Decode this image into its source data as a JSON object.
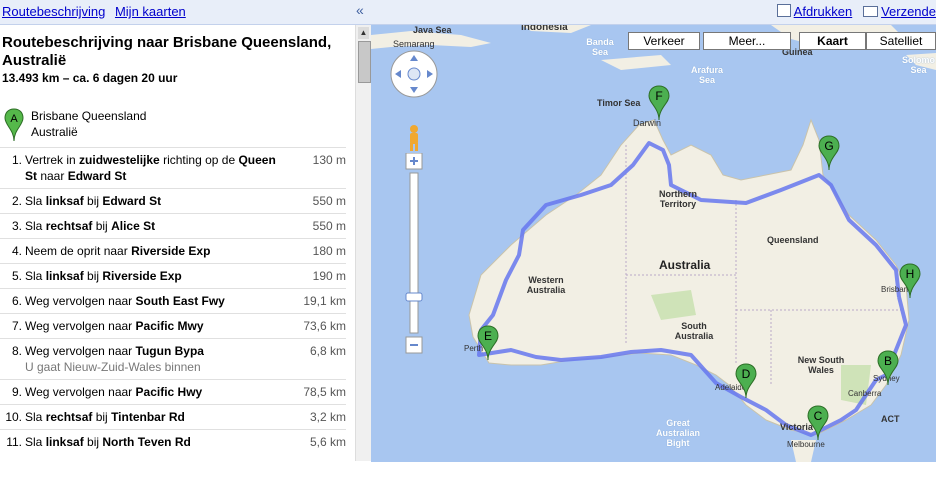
{
  "toplinks": {
    "directions": "Routebeschrijving",
    "mymaps": "Mijn kaarten"
  },
  "collapse_glyph": "«",
  "toolbar": {
    "print": "Afdrukken",
    "send": "Verzende"
  },
  "route": {
    "title": "Routebeschrijving naar Brisbane Queensland, Australië",
    "summary": "13.493 km – ca. 6 dagen 20 uur",
    "start_marker": "A",
    "start_line1": "Brisbane Queensland",
    "start_line2": "Australië",
    "steps": [
      {
        "n": "1.",
        "pre": "Vertrek in ",
        "b1": "zuidwestelijke",
        "mid": " richting op de ",
        "b2": "Queen St",
        "mid2": " naar ",
        "b3": "Edward St",
        "dist": "130 m",
        "note": ""
      },
      {
        "n": "2.",
        "pre": "Sla ",
        "b1": "linksaf",
        "mid": " bij ",
        "b2": "Edward St",
        "mid2": "",
        "b3": "",
        "dist": "550 m",
        "note": ""
      },
      {
        "n": "3.",
        "pre": "Sla ",
        "b1": "rechtsaf",
        "mid": " bij ",
        "b2": "Alice St",
        "mid2": "",
        "b3": "",
        "dist": "550 m",
        "note": ""
      },
      {
        "n": "4.",
        "pre": "Neem de oprit naar ",
        "b1": "Riverside Exp",
        "mid": "",
        "b2": "",
        "mid2": "",
        "b3": "",
        "dist": "180 m",
        "note": ""
      },
      {
        "n": "5.",
        "pre": "Sla ",
        "b1": "linksaf",
        "mid": " bij ",
        "b2": "Riverside Exp",
        "mid2": "",
        "b3": "",
        "dist": "190 m",
        "note": ""
      },
      {
        "n": "6.",
        "pre": "Weg vervolgen naar ",
        "b1": "South East Fwy",
        "mid": "",
        "b2": "",
        "mid2": "",
        "b3": "",
        "dist": "19,1 km",
        "note": ""
      },
      {
        "n": "7.",
        "pre": "Weg vervolgen naar ",
        "b1": "Pacific Mwy",
        "mid": "",
        "b2": "",
        "mid2": "",
        "b3": "",
        "dist": "73,6 km",
        "note": ""
      },
      {
        "n": "8.",
        "pre": "Weg vervolgen naar ",
        "b1": "Tugun Bypa",
        "mid": "",
        "b2": "",
        "mid2": "",
        "b3": "",
        "dist": "6,8 km",
        "note": "U gaat Nieuw-Zuid-Wales binnen"
      },
      {
        "n": "9.",
        "pre": "Weg vervolgen naar ",
        "b1": "Pacific Hwy",
        "mid": "",
        "b2": "",
        "mid2": "",
        "b3": "",
        "dist": "78,5 km",
        "note": ""
      },
      {
        "n": "10.",
        "pre": "Sla ",
        "b1": "rechtsaf",
        "mid": " bij ",
        "b2": "Tintenbar Rd",
        "mid2": "",
        "b3": "",
        "dist": "3,2 km",
        "note": ""
      },
      {
        "n": "11.",
        "pre": "Sla ",
        "b1": "linksaf",
        "mid": " bij ",
        "b2": "North Teven Rd",
        "mid2": "",
        "b3": "",
        "dist": "5,6 km",
        "note": ""
      }
    ]
  },
  "map": {
    "buttons": {
      "traffic": "Verkeer",
      "more": "Meer...",
      "map": "Kaart",
      "satellite": "Satelliet"
    },
    "labels": {
      "java_sea": "Java Sea",
      "semarang": "Semarang",
      "indonesia": "Indonesia",
      "banda_sea": "Banda Sea",
      "arafura_sea": "Arafura Sea",
      "guinea": "Guinea",
      "solomon_sea": "Solomo Sea",
      "timor_sea": "Timor Sea",
      "darwin": "Darwin",
      "northern_territory": "Northern Territory",
      "queensland": "Queensland",
      "western_australia": "Western Australia",
      "australia": "Australia",
      "south_australia": "South Australia",
      "brisbane": "Brisbane",
      "new_south_wales": "New South Wales",
      "sydney": "Sydney",
      "canberra": "Canberra",
      "act": "ACT",
      "perth": "Perth",
      "adelaide": "Adelaide",
      "victoria": "Victoria",
      "melbourne": "Melbourne",
      "great_australian_bight": "Great Australian Bight"
    },
    "markers": [
      "B",
      "C",
      "D",
      "E",
      "F",
      "G",
      "H"
    ],
    "accent_route": "#5a6cf0",
    "marker_color": "#4caf50",
    "land_color": "#f2efe4",
    "water_color": "#a8c6f0"
  }
}
